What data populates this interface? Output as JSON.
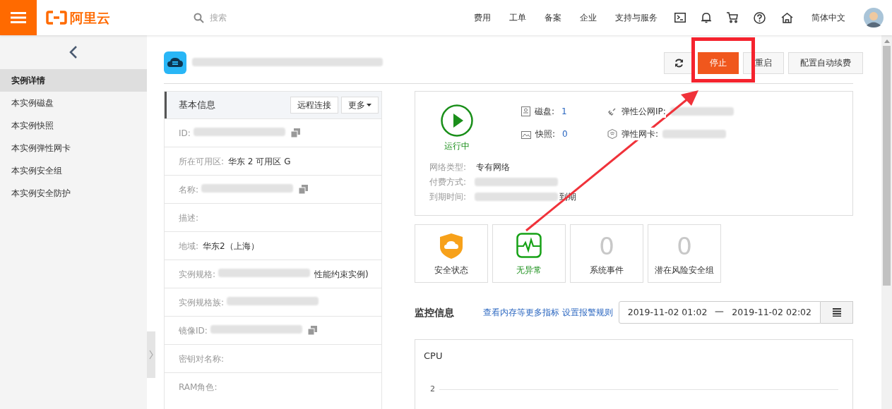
{
  "header": {
    "logo_text": "阿里云",
    "search_placeholder": "搜索",
    "nav": [
      "费用",
      "工单",
      "备案",
      "企业",
      "支持与服务"
    ],
    "language": "简体中文"
  },
  "sidebar": {
    "items": [
      {
        "label": "实例详情",
        "selected": true
      },
      {
        "label": "本实例磁盘",
        "selected": false
      },
      {
        "label": "本实例快照",
        "selected": false
      },
      {
        "label": "本实例弹性网卡",
        "selected": false
      },
      {
        "label": "本实例安全组",
        "selected": false
      },
      {
        "label": "本实例安全防护",
        "selected": false
      }
    ]
  },
  "toolbar": {
    "buttons": [
      {
        "label": "停止",
        "kind": "primary"
      },
      {
        "label": "重启",
        "kind": "default"
      },
      {
        "label": "配置自动续费",
        "kind": "default"
      }
    ]
  },
  "basic_info": {
    "title": "基本信息",
    "actions": [
      "远程连接",
      "更多"
    ],
    "rows": [
      {
        "label": "ID:",
        "redacted": true,
        "copyable": true
      },
      {
        "label": "所在可用区:",
        "value": "华东 2 可用区 G",
        "redacted": false,
        "copyable": false
      },
      {
        "label": "名称:",
        "redacted": true,
        "copyable": true
      },
      {
        "label": "描述:",
        "redacted": false,
        "copyable": false
      },
      {
        "label": "地域:",
        "value": "华东2（上海）",
        "redacted": false,
        "copyable": false
      },
      {
        "label": "实例规格:",
        "value": "性能约束实例)",
        "redacted": true,
        "copyable": false
      },
      {
        "label": "实例规格族:",
        "redacted": true,
        "copyable": false
      },
      {
        "label": "镜像ID:",
        "redacted": true,
        "copyable": true
      },
      {
        "label": "密钥对名称:",
        "redacted": false,
        "copyable": false
      },
      {
        "label": "RAM角色:",
        "redacted": false,
        "copyable": false
      }
    ]
  },
  "status": {
    "label": "运行中",
    "resources": [
      {
        "label": "磁盘:",
        "value": "1",
        "kind": "disk"
      },
      {
        "label": "弹性公网IP:",
        "kind": "ip"
      },
      {
        "label": "快照:",
        "value": "0",
        "kind": "snapshot"
      },
      {
        "label": "弹性网卡:",
        "kind": "nic"
      }
    ],
    "details": [
      {
        "label": "网络类型:",
        "value": "专有网络",
        "redacted": false
      },
      {
        "label": "付费方式:",
        "redacted": true
      },
      {
        "label": "到期时间:",
        "value": "到期",
        "redacted": true
      }
    ]
  },
  "tiles": [
    {
      "kind": "shield",
      "label": "安全状态"
    },
    {
      "kind": "pulse",
      "label": "无异常"
    },
    {
      "kind": "number",
      "value": "0",
      "label": "系统事件"
    },
    {
      "kind": "number",
      "value": "0",
      "label": "潜在风险安全组"
    }
  ],
  "monitor": {
    "title": "监控信息",
    "links": [
      "查看内存等更多指标",
      "设置报警规则"
    ],
    "start": "2019-11-02 01:02",
    "separator": "一",
    "end": "2019-11-02 02:02",
    "chart_title": "CPU",
    "tick": "2"
  }
}
